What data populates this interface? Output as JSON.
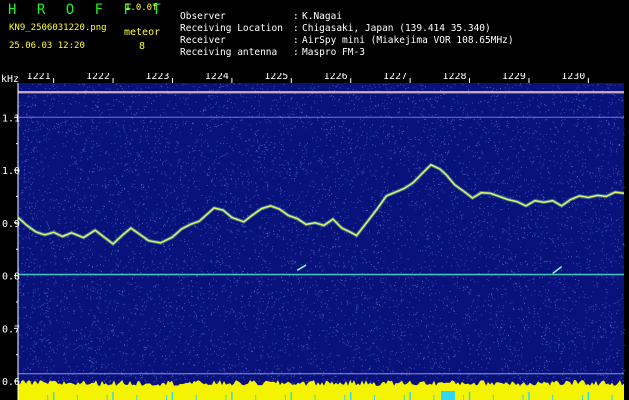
{
  "header": {
    "brand": "H R O F F T",
    "version": "1.0.0f",
    "filename": "KN9_2506031220.png",
    "mode_label": "meteor",
    "mode_value": "8",
    "datetime": "25.06.03 12:20"
  },
  "info": [
    {
      "key": "Observer",
      "value": "K.Nagai"
    },
    {
      "key": "Receiving Location",
      "value": "Chigasaki, Japan (139.414 35.340)"
    },
    {
      "key": "Receiver",
      "value": "AirSpy mini (Miakejima VOR 108.65MHz)"
    },
    {
      "key": "Receiving antenna",
      "value": "Maspro FM-3"
    }
  ],
  "chart_data": {
    "type": "heatmap",
    "y_unit": "kHz",
    "ylim": [
      0.585,
      1.165
    ],
    "y_ticks": [
      "1.1",
      "1.0",
      "0.9",
      "0.8",
      "0.7",
      "0.6"
    ],
    "x_ticks": [
      "1221",
      "1222",
      "1223",
      "1224",
      "1225",
      "1226",
      "1227",
      "1228",
      "1229",
      "1230"
    ],
    "xlim": [
      1220.4,
      1230.6
    ],
    "colors": {
      "background": "#08127a",
      "trace": "#e8f05a",
      "line": "#44ddcc",
      "ref": "#c8c8ff",
      "noise": "#f4f400"
    },
    "horizontal_lines_khz": [
      1.148,
      1.1,
      0.802,
      0.614
    ],
    "trace": [
      [
        1220.4,
        0.91
      ],
      [
        1220.55,
        0.895
      ],
      [
        1220.7,
        0.883
      ],
      [
        1220.85,
        0.877
      ],
      [
        1221.0,
        0.882
      ],
      [
        1221.15,
        0.874
      ],
      [
        1221.3,
        0.881
      ],
      [
        1221.5,
        0.872
      ],
      [
        1221.7,
        0.886
      ],
      [
        1221.85,
        0.873
      ],
      [
        1222.0,
        0.86
      ],
      [
        1222.15,
        0.876
      ],
      [
        1222.3,
        0.89
      ],
      [
        1222.45,
        0.878
      ],
      [
        1222.6,
        0.866
      ],
      [
        1222.8,
        0.862
      ],
      [
        1223.0,
        0.873
      ],
      [
        1223.15,
        0.888
      ],
      [
        1223.3,
        0.897
      ],
      [
        1223.45,
        0.903
      ],
      [
        1223.6,
        0.918
      ],
      [
        1223.7,
        0.928
      ],
      [
        1223.85,
        0.924
      ],
      [
        1224.0,
        0.91
      ],
      [
        1224.2,
        0.902
      ],
      [
        1224.35,
        0.915
      ],
      [
        1224.5,
        0.927
      ],
      [
        1224.65,
        0.932
      ],
      [
        1224.8,
        0.926
      ],
      [
        1224.95,
        0.914
      ],
      [
        1225.1,
        0.908
      ],
      [
        1225.25,
        0.897
      ],
      [
        1225.4,
        0.9
      ],
      [
        1225.55,
        0.895
      ],
      [
        1225.7,
        0.907
      ],
      [
        1225.85,
        0.89
      ],
      [
        1226.0,
        0.882
      ],
      [
        1226.1,
        0.876
      ],
      [
        1226.3,
        0.905
      ],
      [
        1226.45,
        0.927
      ],
      [
        1226.6,
        0.951
      ],
      [
        1226.75,
        0.958
      ],
      [
        1226.9,
        0.965
      ],
      [
        1227.05,
        0.976
      ],
      [
        1227.2,
        0.993
      ],
      [
        1227.35,
        1.01
      ],
      [
        1227.5,
        1.002
      ],
      [
        1227.6,
        0.992
      ],
      [
        1227.75,
        0.972
      ],
      [
        1227.9,
        0.96
      ],
      [
        1228.05,
        0.947
      ],
      [
        1228.2,
        0.957
      ],
      [
        1228.35,
        0.956
      ],
      [
        1228.5,
        0.95
      ],
      [
        1228.65,
        0.944
      ],
      [
        1228.8,
        0.94
      ],
      [
        1228.95,
        0.932
      ],
      [
        1229.1,
        0.942
      ],
      [
        1229.25,
        0.939
      ],
      [
        1229.4,
        0.942
      ],
      [
        1229.55,
        0.932
      ],
      [
        1229.7,
        0.944
      ],
      [
        1229.85,
        0.951
      ],
      [
        1230.0,
        0.948
      ],
      [
        1230.15,
        0.952
      ],
      [
        1230.3,
        0.95
      ],
      [
        1230.45,
        0.958
      ],
      [
        1230.6,
        0.956
      ]
    ],
    "meteor_traces": [
      [
        [
          1225.1,
          0.81
        ],
        [
          1225.25,
          0.82
        ]
      ],
      [
        [
          1229.4,
          0.804
        ],
        [
          1229.55,
          0.817
        ]
      ]
    ]
  }
}
